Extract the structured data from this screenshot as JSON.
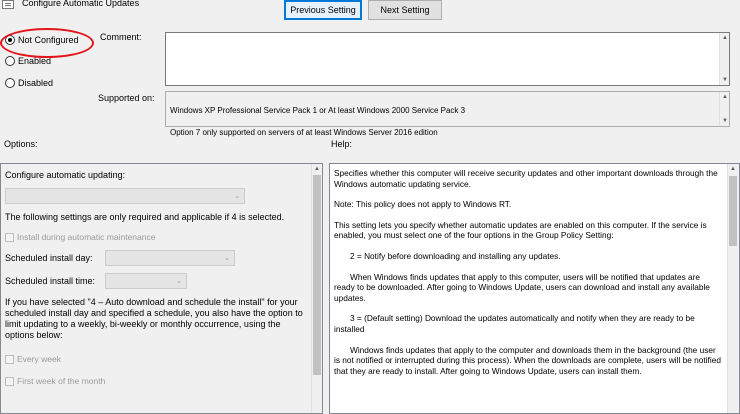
{
  "window": {
    "title": "Configure Automatic Updates"
  },
  "nav": {
    "previous_label": "Previous Setting",
    "next_label": "Next Setting"
  },
  "state": {
    "options": [
      {
        "label": "Not Configured",
        "selected": true
      },
      {
        "label": "Enabled",
        "selected": false
      },
      {
        "label": "Disabled",
        "selected": false
      }
    ]
  },
  "comment": {
    "label": "Comment:",
    "value": ""
  },
  "supported": {
    "label": "Supported on:",
    "line1": "Windows XP Professional Service Pack 1 or At least Windows 2000 Service Pack 3",
    "line2": "Option 7 only supported on servers of at least Windows Server 2016 edition"
  },
  "options_panel": {
    "header": "Options:",
    "configure_label": "Configure automatic updating:",
    "configure_value": "",
    "note": "The following settings are only required and applicable if 4 is selected.",
    "maintenance_label": "Install during automatic maintenance",
    "install_day_label": "Scheduled install day:",
    "install_day_value": "",
    "install_time_label": "Scheduled install time:",
    "install_time_value": "",
    "schedule_note": "If you have selected \"4 – Auto download and schedule the install\" for your scheduled install day and specified a schedule, you also have the option to limit updating to a weekly, bi-weekly or monthly occurrence, using the options below:",
    "every_week_label": "Every week",
    "first_week_label": "First week of the month"
  },
  "help_panel": {
    "header": "Help:",
    "paragraphs": [
      "Specifies whether this computer will receive security updates and other important downloads through the Windows automatic updating service.",
      "Note: This policy does not apply to Windows RT.",
      "This setting lets you specify whether automatic updates are enabled on this computer. If the service is enabled, you must select one of the four options in the Group Policy Setting:",
      "2 = Notify before downloading and installing any updates.",
      "When Windows finds updates that apply to this computer, users will be notified that updates are ready to be downloaded. After going to Windows Update, users can download and install any available updates.",
      "3 = (Default setting) Download the updates automatically and notify when they are ready to be installed",
      "Windows finds updates that apply to the computer and downloads them in the background (the user is not notified or interrupted during this process). When the downloads are complete, users will be notified that they are ready to install. After going to Windows Update, users can install them."
    ]
  },
  "colors": {
    "highlight_ellipse": "#e3151a",
    "primary_button_border": "#0078d7"
  }
}
